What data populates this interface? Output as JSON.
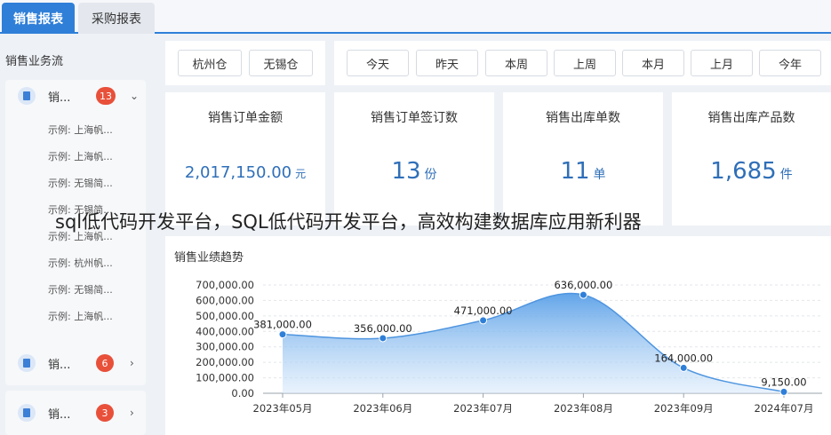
{
  "tabs": [
    {
      "label": "销售报表",
      "active": true
    },
    {
      "label": "采购报表",
      "active": false
    }
  ],
  "sidebar": {
    "title": "销售业务流",
    "groups": [
      {
        "label": "销...",
        "badge": "13",
        "expanded": true,
        "items": [
          "示例: 上海帆...",
          "示例: 上海帆...",
          "示例: 无锡简...",
          "示例: 无锡简...",
          "示例: 上海帆...",
          "示例: 杭州帆...",
          "示例: 无锡简...",
          "示例: 上海帆..."
        ]
      },
      {
        "label": "销...",
        "badge": "6",
        "expanded": false
      },
      {
        "label": "销...",
        "badge": "3",
        "expanded": false
      }
    ]
  },
  "warehouse_filters": [
    "杭州仓",
    "无锡仓"
  ],
  "date_filters": [
    "今天",
    "昨天",
    "本周",
    "上周",
    "本月",
    "上月",
    "今年"
  ],
  "kpis": [
    {
      "title": "销售订单金额",
      "value": "2,017,150.00",
      "unit": "元"
    },
    {
      "title": "销售订单签订数",
      "value": "13",
      "unit": "份"
    },
    {
      "title": "销售出库单数",
      "value": "11",
      "unit": "单"
    },
    {
      "title": "销售出库产品数",
      "value": "1,685",
      "unit": "件"
    }
  ],
  "overlay_text": "sql低代码开发平台，SQL低代码开发平台，高效构建数据库应用新利器",
  "colors": {
    "accent": "#2f7fd8",
    "badge": "#e8503a",
    "kpi_value": "#2f6fb8",
    "series": "#4f95e0"
  },
  "chart_data": {
    "type": "area",
    "title": "销售业绩趋势",
    "categories": [
      "2023年05月",
      "2023年06月",
      "2023年07月",
      "2023年08月",
      "2023年09月",
      "2024年07月"
    ],
    "values": [
      381000,
      356000,
      471000,
      636000,
      164000,
      9150
    ],
    "data_labels": [
      "381,000.00",
      "356,000.00",
      "471,000.00",
      "636,000.00",
      "164,000.00",
      "9,150.00"
    ],
    "yticks": [
      "0.00",
      "100,000.00",
      "200,000.00",
      "300,000.00",
      "400,000.00",
      "500,000.00",
      "600,000.00",
      "700,000.00"
    ],
    "ylim": [
      0,
      700000
    ],
    "grid": true,
    "smooth": true
  }
}
